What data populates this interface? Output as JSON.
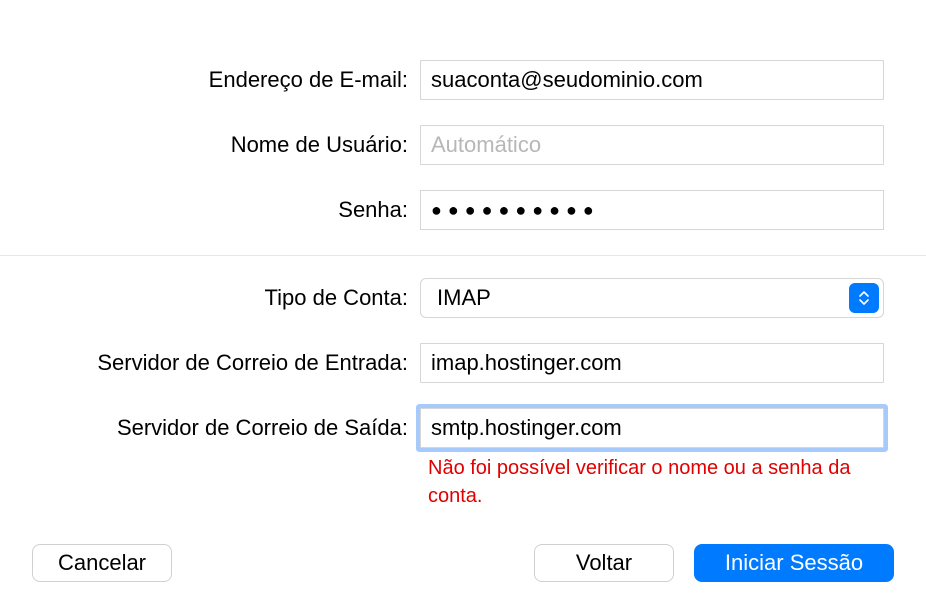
{
  "fields": {
    "email": {
      "label": "Endereço de E-mail:",
      "value": "suaconta@seudominio.com"
    },
    "username": {
      "label": "Nome de Usuário:",
      "placeholder": "Automático",
      "value": ""
    },
    "password": {
      "label": "Senha:",
      "masked": "●●●●●●●●●●"
    },
    "account_type": {
      "label": "Tipo de Conta:",
      "value": "IMAP"
    },
    "incoming": {
      "label": "Servidor de Correio de Entrada:",
      "value": "imap.hostinger.com"
    },
    "outgoing": {
      "label": "Servidor de Correio de Saída:",
      "value": "smtp.hostinger.com"
    }
  },
  "error_message": "Não foi possível verificar o nome ou a senha da conta.",
  "buttons": {
    "cancel": "Cancelar",
    "back": "Voltar",
    "signin": "Iniciar Sessão"
  }
}
